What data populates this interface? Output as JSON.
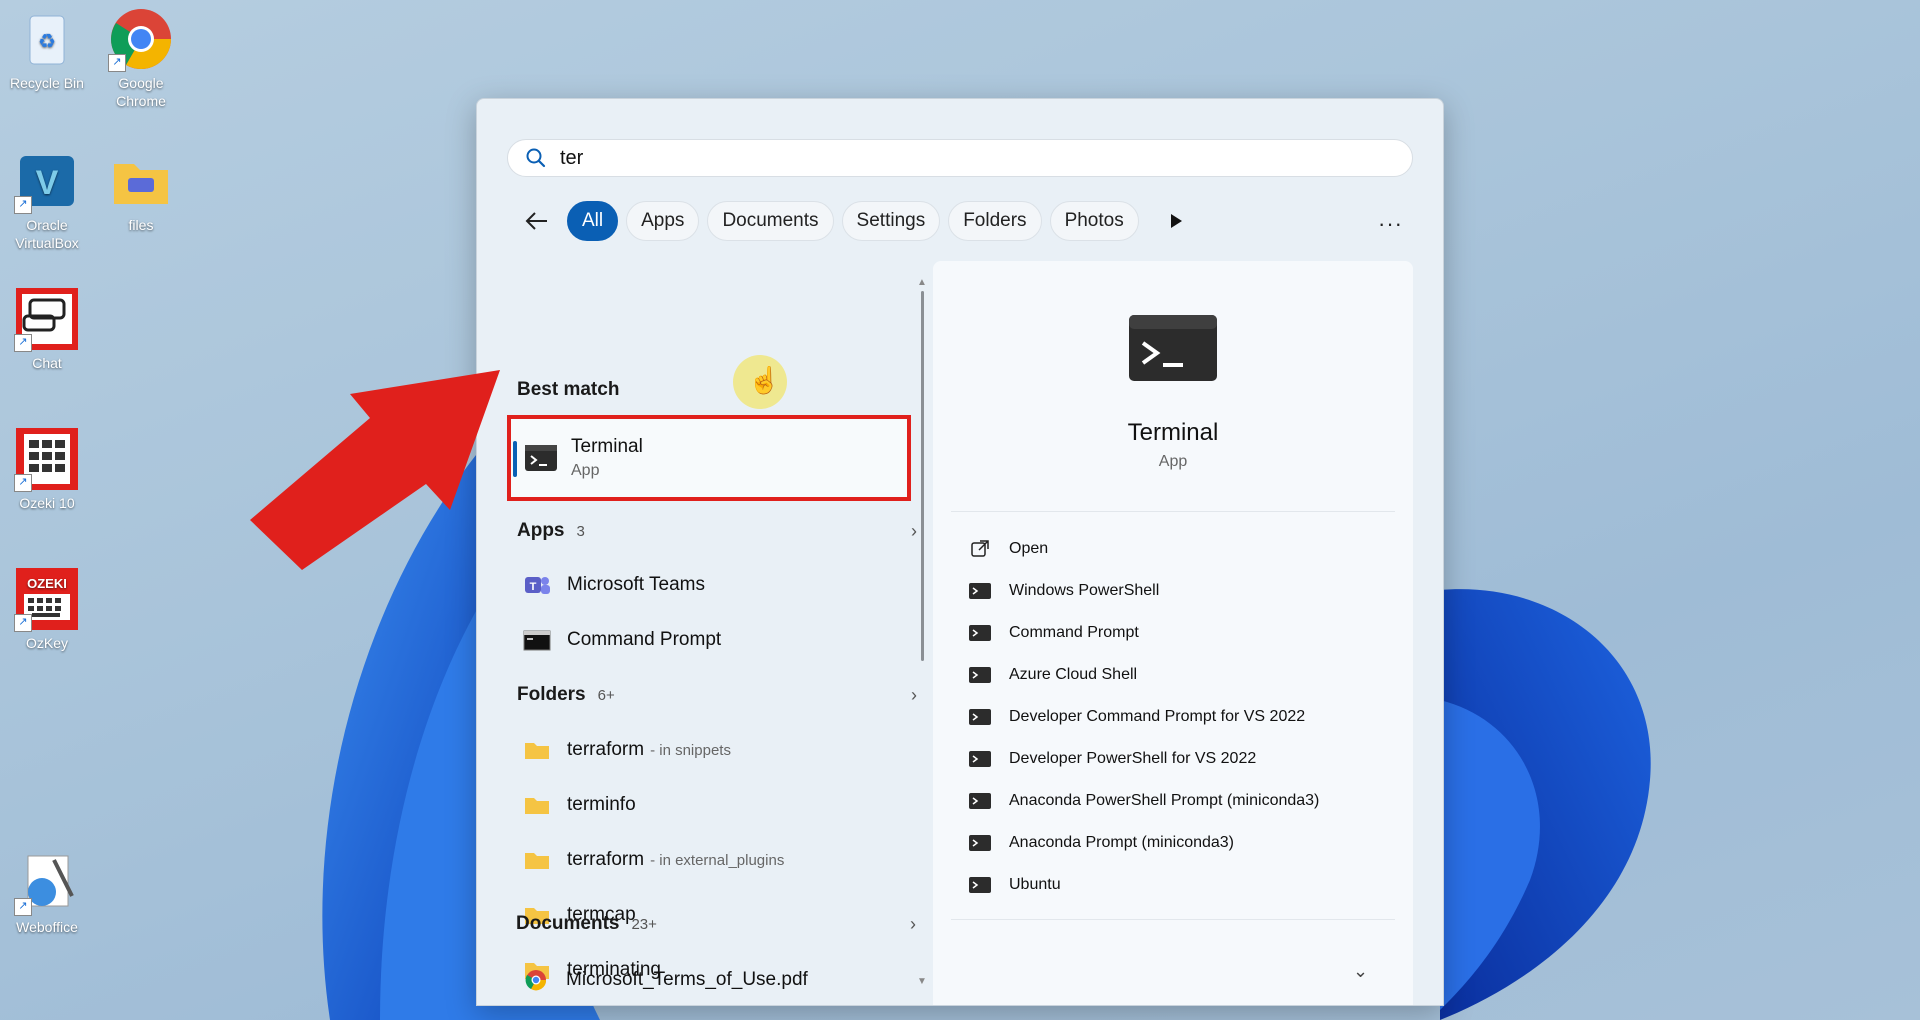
{
  "desktop": {
    "icons": [
      {
        "label": "Recycle Bin"
      },
      {
        "label": "Google Chrome"
      },
      {
        "label": "Oracle VirtualBox"
      },
      {
        "label": "files"
      },
      {
        "label": "Chat"
      },
      {
        "label": "Ozeki 10"
      },
      {
        "label": "OZEKI",
        "sub": "OzKey"
      },
      {
        "label": "Weboffice"
      }
    ]
  },
  "search": {
    "value": "ter",
    "placeholder": ""
  },
  "filters": [
    "All",
    "Apps",
    "Documents",
    "Settings",
    "Folders",
    "Photos"
  ],
  "results": {
    "best_match_title": "Best match",
    "best_match": {
      "name": "Terminal",
      "type": "App"
    },
    "apps_section": {
      "label": "Apps",
      "count": "3"
    },
    "apps": [
      "Microsoft Teams",
      "Command Prompt"
    ],
    "folders_section": {
      "label": "Folders",
      "count": "6+"
    },
    "folders": [
      {
        "name": "terraform",
        "sub": "- in snippets"
      },
      {
        "name": "terminfo",
        "sub": ""
      },
      {
        "name": "terraform",
        "sub": "- in external_plugins"
      },
      {
        "name": "termcap",
        "sub": ""
      },
      {
        "name": "terminating",
        "sub": ""
      }
    ],
    "documents_section": {
      "label": "Documents",
      "count": "23+"
    },
    "documents": [
      "Microsoft_Terms_of_Use.pdf"
    ]
  },
  "details": {
    "name": "Terminal",
    "type": "App",
    "actions": [
      "Open",
      "Windows PowerShell",
      "Command Prompt",
      "Azure Cloud Shell",
      "Developer Command Prompt for VS 2022",
      "Developer PowerShell for VS 2022",
      "Anaconda PowerShell Prompt (miniconda3)",
      "Anaconda Prompt (miniconda3)",
      "Ubuntu"
    ]
  },
  "colors": {
    "accent": "#0a5fb4",
    "highlight": "#e0201c"
  }
}
